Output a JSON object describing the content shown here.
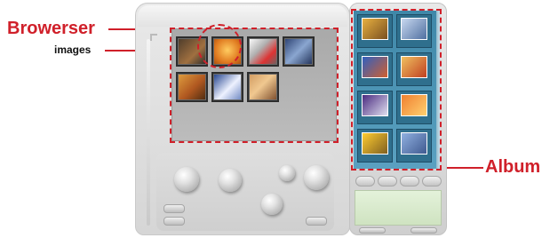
{
  "labels": {
    "browser": "Browerser",
    "images": "images",
    "album": "Album"
  },
  "colors": {
    "annotation_red": "#d0202a",
    "album_blue": "#4a93b4",
    "browser_gray": "#b3b3b3"
  },
  "browser_thumbnails": [
    {
      "name": "thumb-1",
      "fill": "linear-gradient(135deg,#4a3a2a,#a07040 60%,#2a2a2a)"
    },
    {
      "name": "thumb-2-selected",
      "fill": "radial-gradient(circle at 50% 45%,#ffcc60,#e07a20 60%,#a04a10)"
    },
    {
      "name": "thumb-3",
      "fill": "linear-gradient(135deg,#ffffff,#b0b0b0 40%,#d33 70%,#666)"
    },
    {
      "name": "thumb-4",
      "fill": "linear-gradient(135deg,#2a3f70,#8aa6d0 50%,#1e2e55)"
    },
    {
      "name": "thumb-5",
      "fill": "linear-gradient(135deg,#e0a040,#b05820 55%,#4a2a10)"
    },
    {
      "name": "thumb-6",
      "fill": "linear-gradient(135deg,#1c3d8a,#eef2ff 55%,#6a84c0)"
    },
    {
      "name": "thumb-7",
      "fill": "linear-gradient(135deg,#d09a60,#f0c890 45%,#7a4a2a)"
    },
    {
      "name": "thumb-8",
      "fill": "linear-gradient(135deg,#6a6a6a,#2a2a2a 60%,#555)"
    }
  ],
  "album_items": [
    {
      "name": "album-item-1",
      "fill": "linear-gradient(135deg,#e8b040,#7a5020)"
    },
    {
      "name": "album-item-2",
      "fill": "linear-gradient(135deg,#c8d8f0,#5070a0)"
    },
    {
      "name": "album-item-3",
      "fill": "linear-gradient(135deg,#3060c0,#d06030)"
    },
    {
      "name": "album-item-4",
      "fill": "linear-gradient(135deg,#f0c060,#c04020)"
    },
    {
      "name": "album-item-5",
      "fill": "linear-gradient(135deg,#4a2a80,#e0e0f0)"
    },
    {
      "name": "album-item-6",
      "fill": "linear-gradient(135deg,#f08030,#ffd070)"
    },
    {
      "name": "album-item-7",
      "fill": "linear-gradient(135deg,#ffcc30,#806020)"
    },
    {
      "name": "album-item-8",
      "fill": "linear-gradient(135deg,#90b0e0,#405a90)"
    }
  ]
}
